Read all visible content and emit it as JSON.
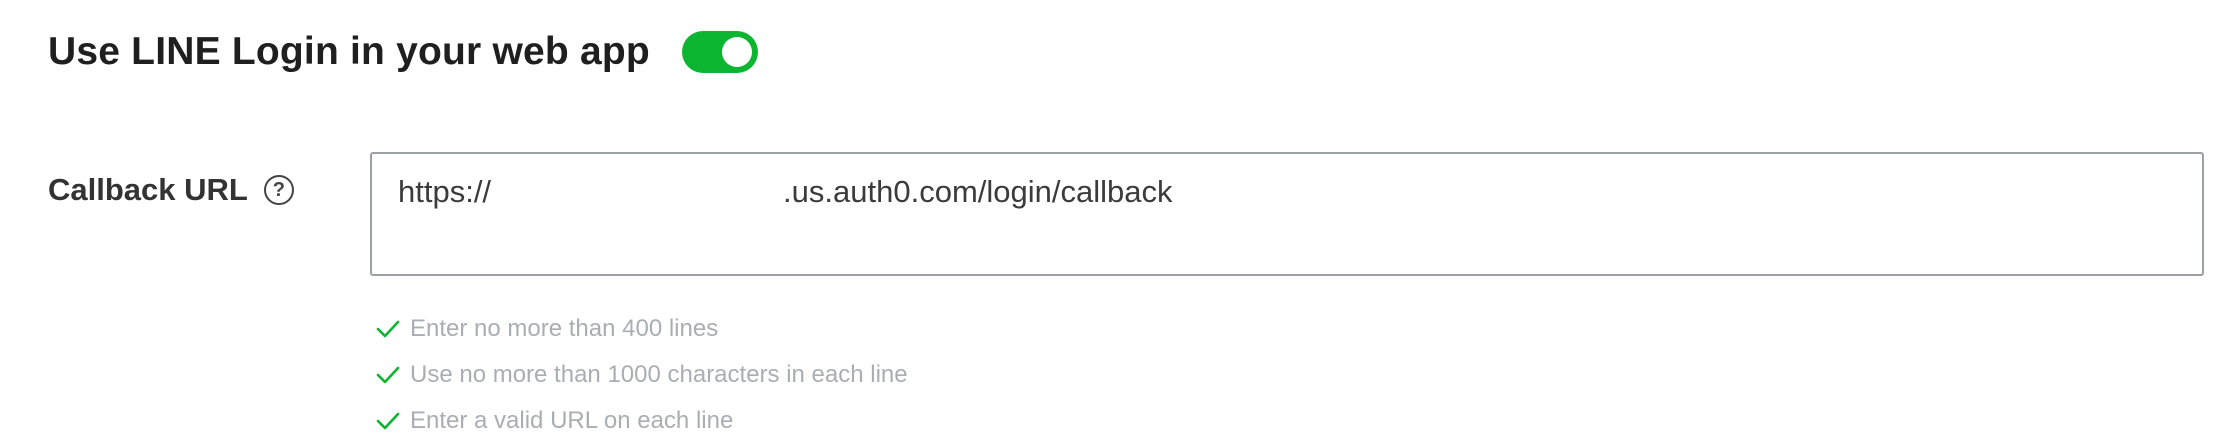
{
  "header": {
    "title": "Use LINE Login in your web app",
    "toggle_on": true,
    "toggle_color": "#0cb530"
  },
  "callback": {
    "label": "Callback URL",
    "help_icon": "question-circle-icon",
    "help_glyph": "?",
    "value_prefix": "https://",
    "value_suffix": ".us.auth0.com/login/callback"
  },
  "rules": [
    {
      "icon": "check-icon",
      "text": "Enter no more than 400 lines"
    },
    {
      "icon": "check-icon",
      "text": "Use no more than 1000 characters in each line"
    },
    {
      "icon": "check-icon",
      "text": "Enter a valid URL on each line"
    }
  ],
  "colors": {
    "check": "#0cb530",
    "rule_text": "#a9aeb4"
  }
}
